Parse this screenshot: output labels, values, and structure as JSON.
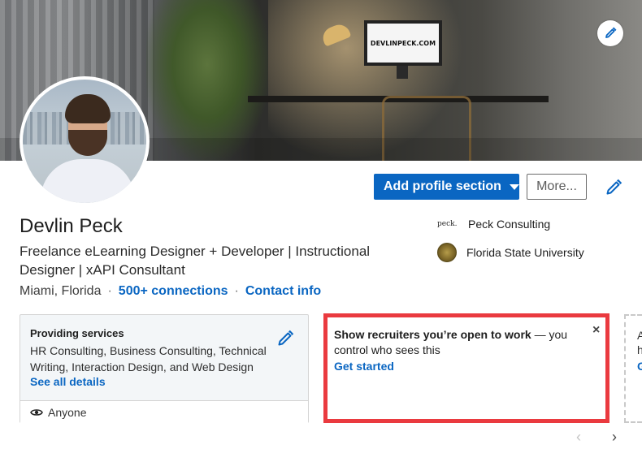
{
  "cover": {
    "monitor_text": "DEVLINPECK.COM",
    "edit_icon": "pencil-icon"
  },
  "profile": {
    "name": "Devlin Peck",
    "headline": "Freelance eLearning Designer + Developer | Instructional Designer | xAPI Consultant",
    "location": "Miami, Florida",
    "separator": "·",
    "connections": "500+ connections",
    "contact": "Contact info"
  },
  "actions": {
    "add_section": "Add profile section",
    "more": "More..."
  },
  "orgs": {
    "company": {
      "name": "Peck Consulting",
      "logo_text": "peck."
    },
    "school": {
      "name": "Florida State University"
    }
  },
  "services_card": {
    "title": "Providing services",
    "description": "HR Consulting, Business Consulting, Technical Writing, Interaction Design, and Web Design",
    "details_link": "See all details",
    "visibility": "Anyone"
  },
  "open_to_work_card": {
    "text_bold": "Show recruiters you’re open to work",
    "text_rest": " — you control who sees this",
    "cta": "Get started",
    "close": "×"
  },
  "partial_card": {
    "line1": "A",
    "line2": "h",
    "line3": "G"
  },
  "pager": {
    "prev": "‹",
    "next": "›"
  },
  "colors": {
    "primary": "#0a66c2",
    "highlight_border": "#ea3a3f",
    "card_bg": "#f3f6f8"
  }
}
